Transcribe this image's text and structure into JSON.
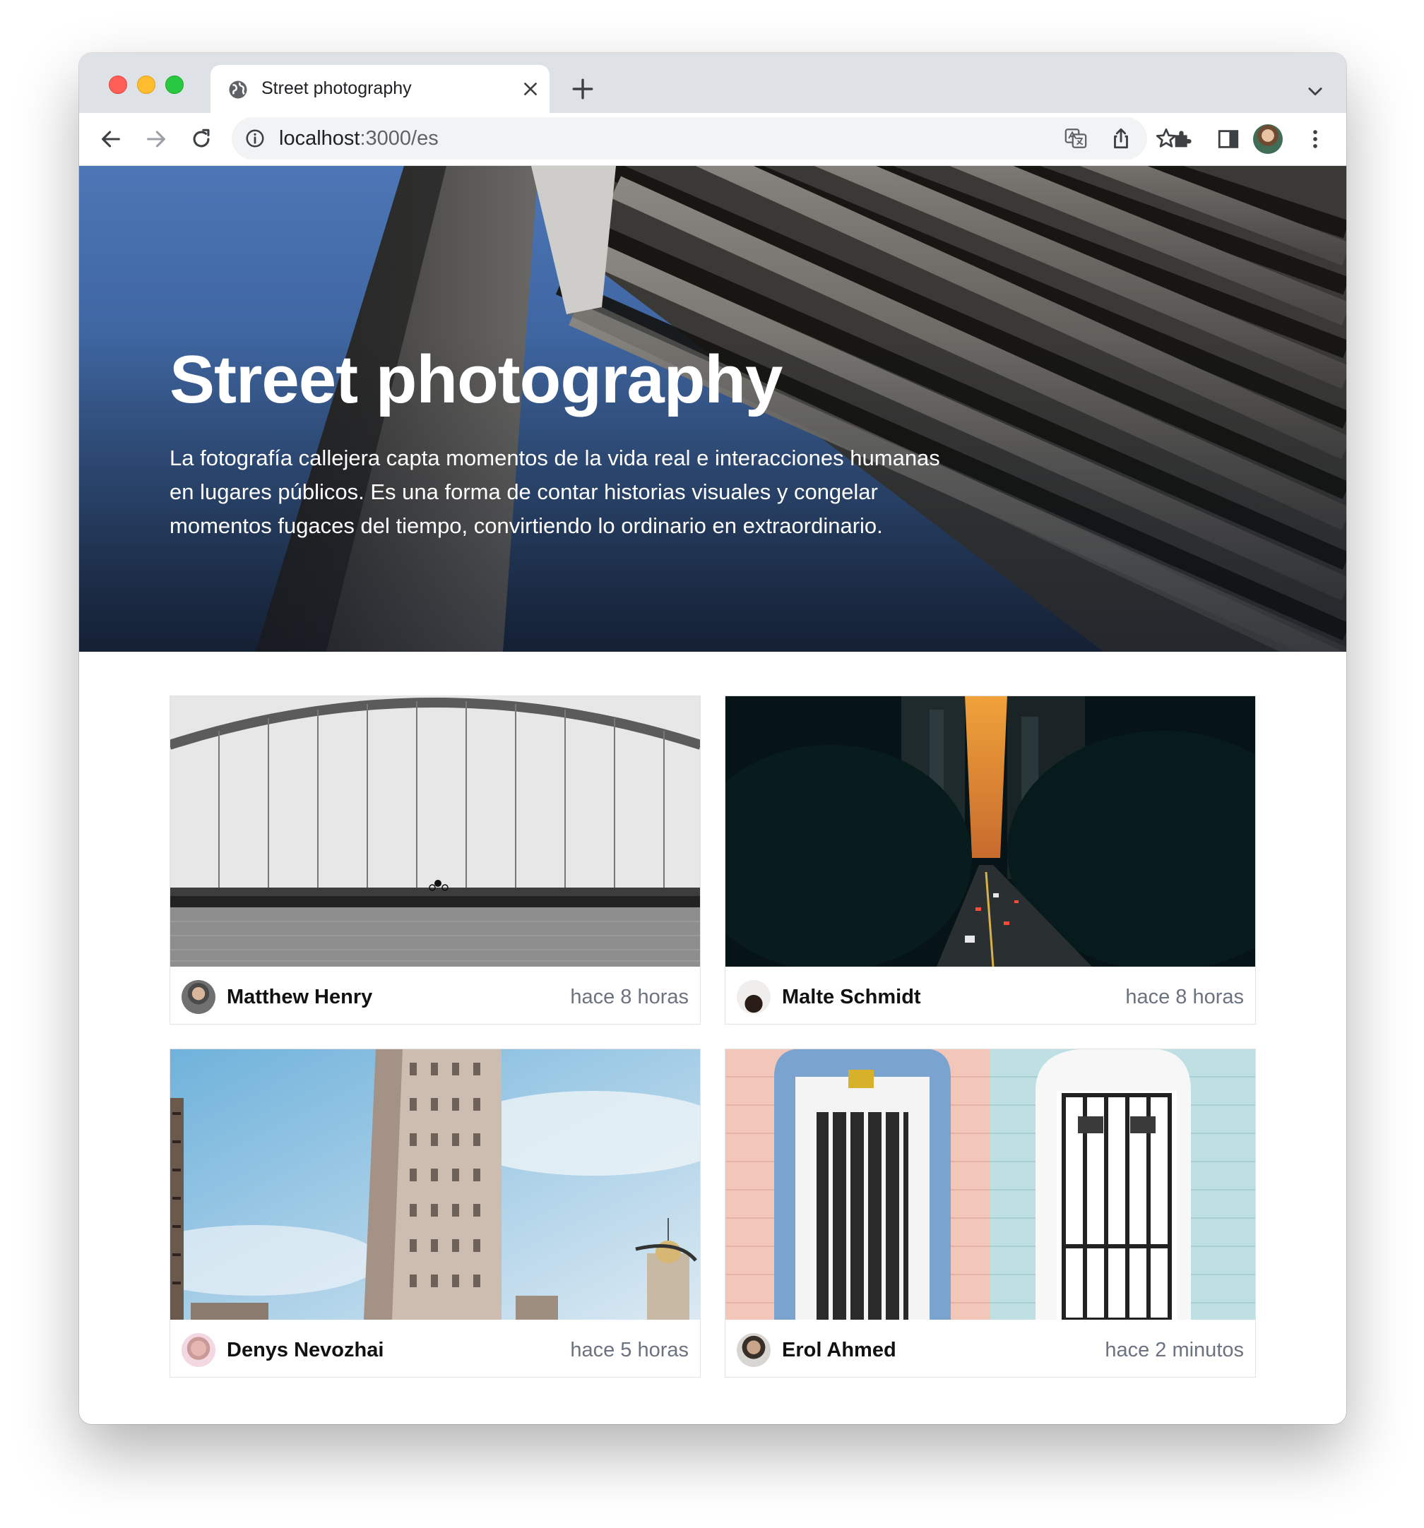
{
  "browser": {
    "tab": {
      "title": "Street photography"
    },
    "url": {
      "host": "localhost",
      "path": ":3000/es"
    }
  },
  "hero": {
    "title": "Street photography",
    "description": "La fotografía callejera capta momentos de la vida real e interacciones humanas en lugares públicos. Es una forma de contar historias visuales y congelar momentos fugaces del tiempo, convirtiendo lo ordinario en extraordinario."
  },
  "cards": [
    {
      "author": "Matthew Henry",
      "time": "hace 8 horas"
    },
    {
      "author": "Malte Schmidt",
      "time": "hace 8 horas"
    },
    {
      "author": "Denys Nevozhai",
      "time": "hace 5 horas"
    },
    {
      "author": "Erol Ahmed",
      "time": "hace 2 minutos"
    }
  ],
  "icons": {
    "favicon": "globe-icon",
    "close": "close-icon",
    "new_tab": "plus-icon",
    "tab_search": "chevron-down-icon",
    "back": "arrow-left-icon",
    "forward": "arrow-right-icon",
    "reload": "reload-icon",
    "site_info": "info-icon",
    "translate": "translate-icon",
    "share": "share-icon",
    "bookmark": "star-icon",
    "extensions": "puzzle-icon",
    "side_panel": "side-panel-icon",
    "menu": "kebab-menu-icon"
  }
}
